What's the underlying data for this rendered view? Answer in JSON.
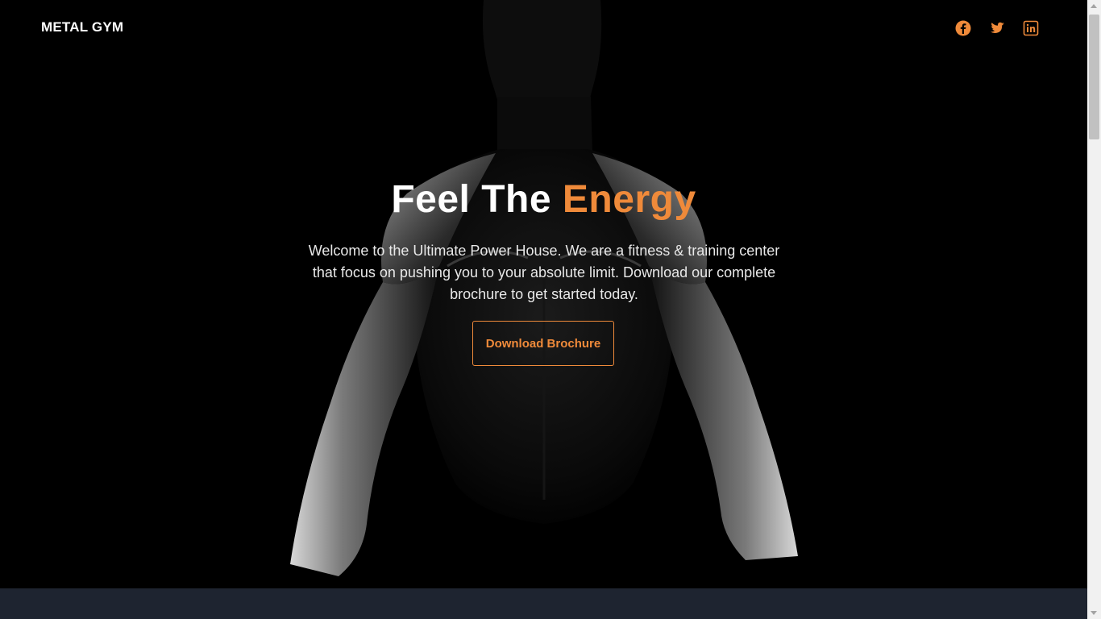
{
  "nav": {
    "brand": "METAL GYM",
    "social_icons": [
      "facebook-icon",
      "twitter-icon",
      "linkedin-icon"
    ]
  },
  "hero": {
    "headline_part1": "Feel The ",
    "headline_accent": "Energy",
    "description": "Welcome to the Ultimate Power House. We are a fitness & training center that focus on pushing you to your absolute limit. Download our complete brochure to get started today.",
    "cta_label": "Download Brochure"
  },
  "colors": {
    "accent": "#ef8a3a",
    "background": "#000000",
    "footer_strip": "#1e2430"
  }
}
